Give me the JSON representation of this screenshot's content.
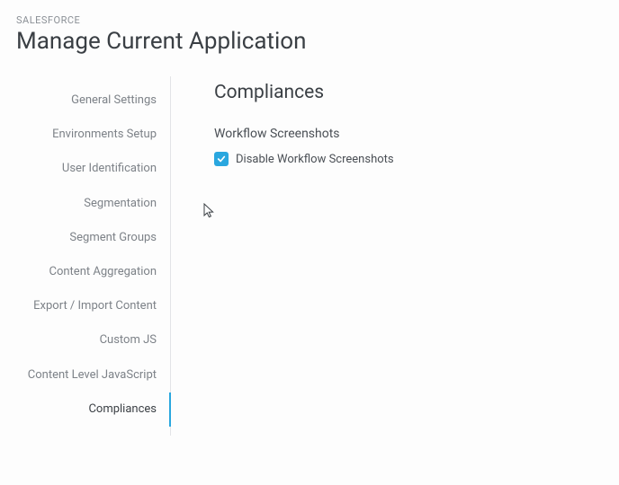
{
  "header": {
    "eyebrow": "SALESFORCE",
    "title": "Manage Current Application"
  },
  "sidebar": {
    "items": [
      {
        "label": "General Settings",
        "active": false
      },
      {
        "label": "Environments Setup",
        "active": false
      },
      {
        "label": "User Identification",
        "active": false
      },
      {
        "label": "Segmentation",
        "active": false
      },
      {
        "label": "Segment Groups",
        "active": false
      },
      {
        "label": "Content Aggregation",
        "active": false
      },
      {
        "label": "Export / Import Content",
        "active": false
      },
      {
        "label": "Custom JS",
        "active": false
      },
      {
        "label": "Content Level JavaScript",
        "active": false
      },
      {
        "label": "Compliances",
        "active": true
      }
    ]
  },
  "content": {
    "section_title": "Compliances",
    "workflow": {
      "heading": "Workflow Screenshots",
      "checkbox_label": "Disable Workflow Screenshots",
      "checked": true
    }
  },
  "colors": {
    "accent": "#2aa7df"
  }
}
